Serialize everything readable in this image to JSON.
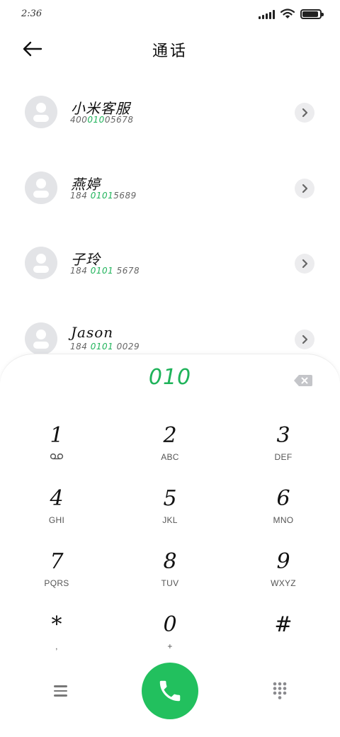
{
  "status": {
    "time": "2:36",
    "battery_level": 0.9,
    "icons": [
      "signal-icon",
      "wifi-icon",
      "battery-icon"
    ]
  },
  "header": {
    "title": "通话",
    "back_icon": "back-arrow-icon"
  },
  "contacts": [
    {
      "name": "小米客服",
      "number_pre": "400",
      "number_match": "010",
      "number_post": "05678"
    },
    {
      "name": "燕婷",
      "number_pre": "184 ",
      "number_match": "0101",
      "number_post": "5689"
    },
    {
      "name": "子玲",
      "number_pre": "184 ",
      "number_match": "0101",
      "number_post": " 5678"
    },
    {
      "name": "Jason",
      "number_pre": "184 ",
      "number_match": "0101",
      "number_post": " 0029"
    }
  ],
  "dialpad": {
    "dialed": "010",
    "keys": [
      {
        "digit": "1",
        "letters": ""
      },
      {
        "digit": "2",
        "letters": "ABC"
      },
      {
        "digit": "3",
        "letters": "DEF"
      },
      {
        "digit": "4",
        "letters": "GHI"
      },
      {
        "digit": "5",
        "letters": "JKL"
      },
      {
        "digit": "6",
        "letters": "MNO"
      },
      {
        "digit": "7",
        "letters": "PQRS"
      },
      {
        "digit": "8",
        "letters": "TUV"
      },
      {
        "digit": "9",
        "letters": "WXYZ"
      },
      {
        "digit": "*",
        "letters": ","
      },
      {
        "digit": "0",
        "letters": "+"
      },
      {
        "digit": "#",
        "letters": ""
      }
    ],
    "icons": [
      "voicemail-icon",
      "menu-icon",
      "phone-call-icon",
      "dialpad-grid-icon",
      "backspace-icon"
    ]
  },
  "colors": {
    "accent": "#1fb35a",
    "call_button": "#22c05e",
    "avatar_bg": "#e3e4e7"
  }
}
